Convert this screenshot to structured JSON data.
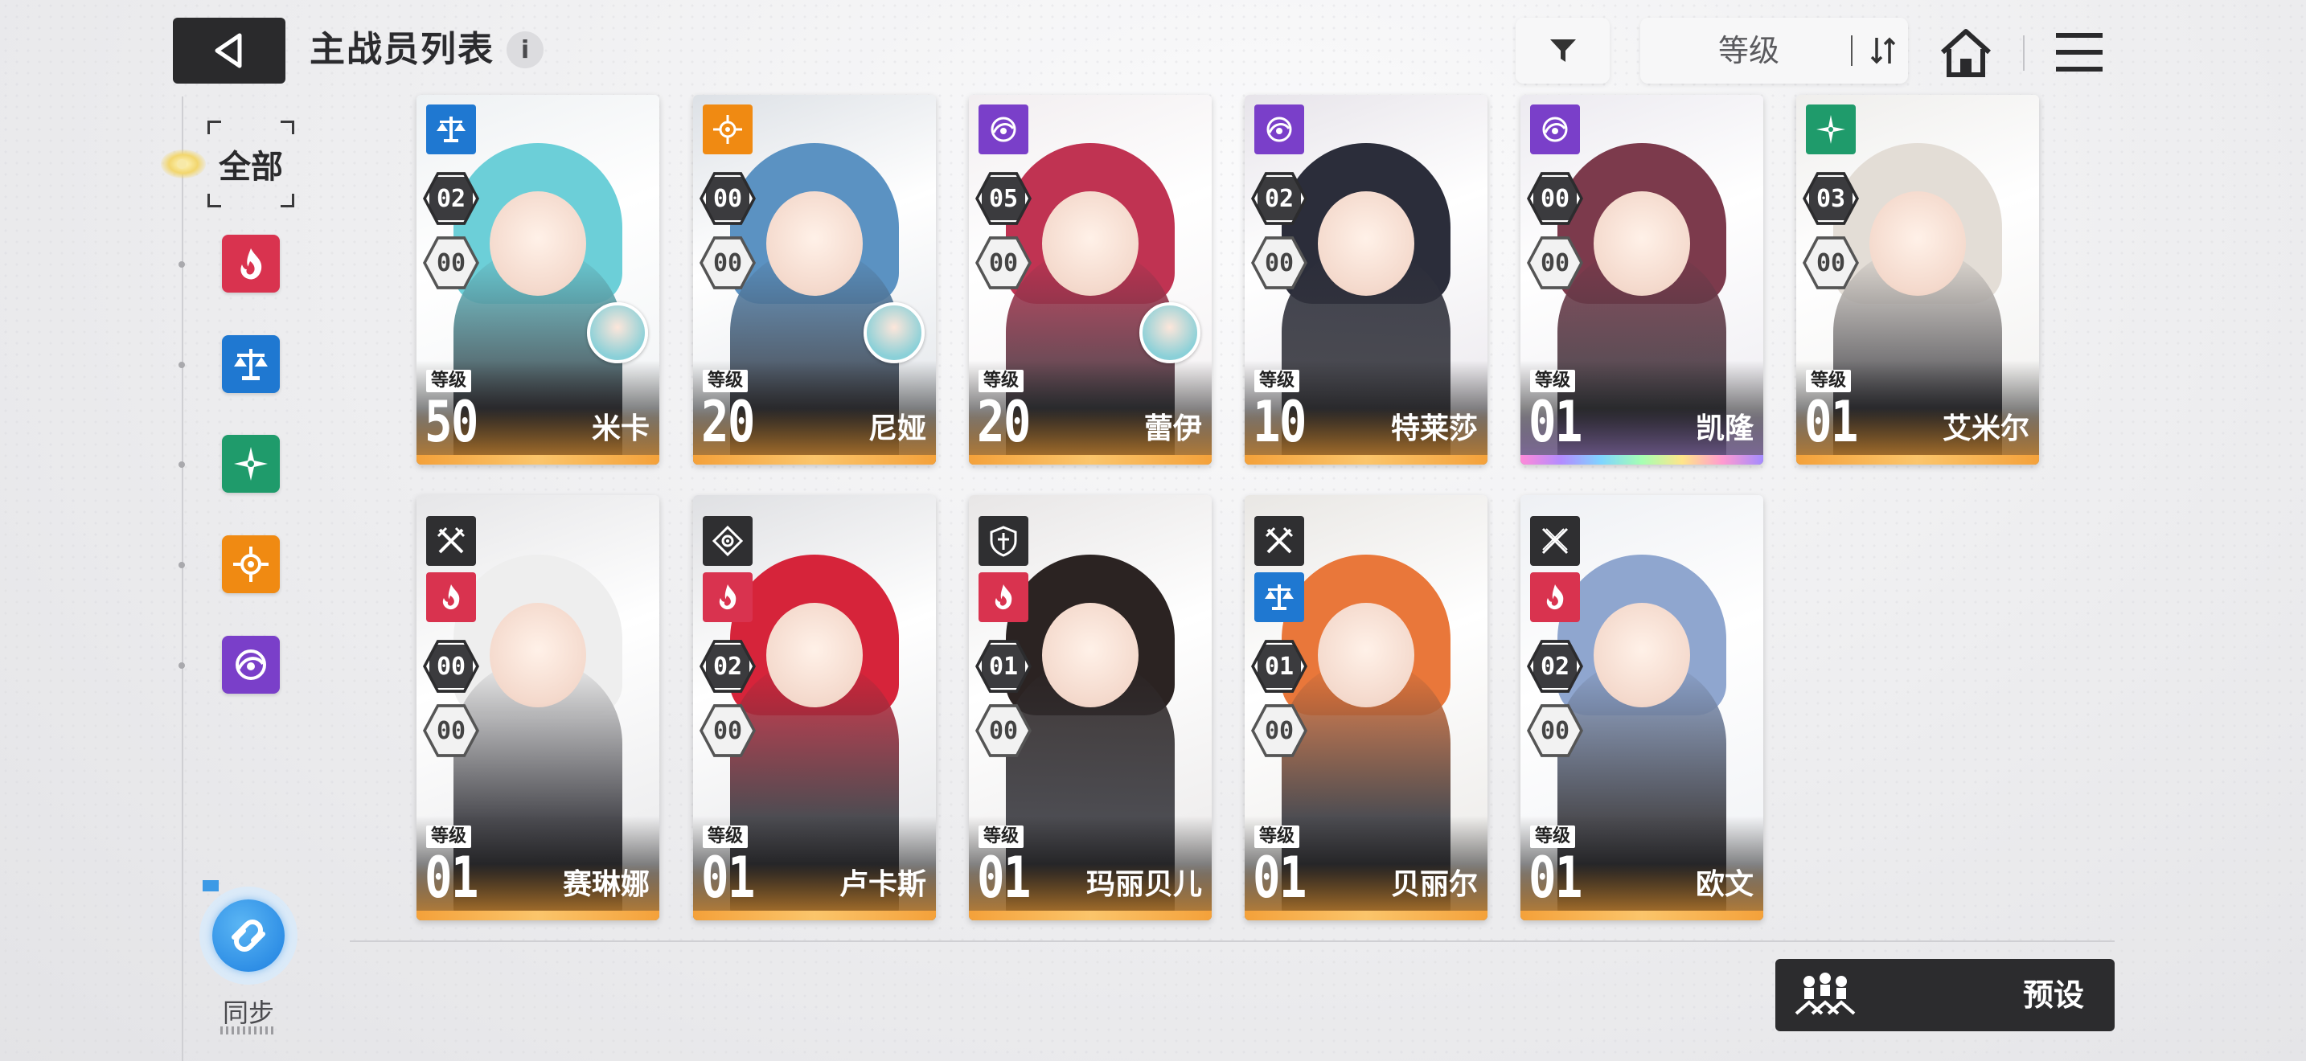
{
  "header": {
    "title": "主战员列表",
    "info_icon": "i",
    "sort_label": "等级",
    "icons": [
      "back-arrow-icon",
      "filter-funnel-icon",
      "sort-toggle-icon",
      "home-icon",
      "menu-icon"
    ]
  },
  "sidebar": {
    "all_label": "全部",
    "elements": [
      {
        "name": "fire",
        "color": "#d9334f"
      },
      {
        "name": "balance",
        "color": "#1f78d1"
      },
      {
        "name": "wind",
        "color": "#1f9b6b"
      },
      {
        "name": "radiant",
        "color": "#f08a12"
      },
      {
        "name": "void",
        "color": "#7a3fc9"
      }
    ],
    "sync_label": "同步"
  },
  "cards": [
    {
      "name": "米卡",
      "level_label": "等级",
      "level": "50",
      "upper": "02",
      "lower": "00",
      "element": "balance",
      "elem_color": "#1f78d1",
      "rarity": "orange",
      "has_avatar": true,
      "hair": "#6ccfd8",
      "bg": "#eef1f3"
    },
    {
      "name": "尼娅",
      "level_label": "等级",
      "level": "20",
      "upper": "00",
      "lower": "00",
      "element": "radiant",
      "elem_color": "#f08a12",
      "rarity": "orange",
      "has_avatar": true,
      "hair": "#5b92c2",
      "bg": "#dde1e6"
    },
    {
      "name": "蕾伊",
      "level_label": "等级",
      "level": "20",
      "upper": "05",
      "lower": "00",
      "element": "void",
      "elem_color": "#7a3fc9",
      "rarity": "orange",
      "has_avatar": true,
      "hair": "#c03352",
      "bg": "#f2eef0"
    },
    {
      "name": "特莱莎",
      "level_label": "等级",
      "level": "10",
      "upper": "02",
      "lower": "00",
      "element": "void",
      "elem_color": "#7a3fc9",
      "rarity": "orange",
      "has_avatar": false,
      "hair": "#2b2d3a",
      "bg": "#e7e4ea"
    },
    {
      "name": "凯隆",
      "level_label": "等级",
      "level": "01",
      "upper": "00",
      "lower": "00",
      "element": "void",
      "elem_color": "#7a3fc9",
      "rarity": "rainbow",
      "has_avatar": false,
      "hair": "#7c3a4c",
      "bg": "#eceaf0"
    },
    {
      "name": "艾米尔",
      "level_label": "等级",
      "level": "01",
      "upper": "03",
      "lower": "00",
      "element": "wind",
      "elem_color": "#1f9b6b",
      "rarity": "orange",
      "has_avatar": false,
      "hair": "#e3ddd6",
      "bg": "#efeeec"
    },
    {
      "name": "赛琳娜",
      "level_label": "等级",
      "level": "01",
      "upper": "00",
      "lower": "00",
      "element": "fire",
      "elem_color": "#d9334f",
      "rarity": "orange",
      "role": "swords",
      "hair": "#eeeeee",
      "bg": "#e6e6e8"
    },
    {
      "name": "卢卡斯",
      "level_label": "等级",
      "level": "01",
      "upper": "02",
      "lower": "00",
      "element": "fire",
      "elem_color": "#d9334f",
      "rarity": "orange",
      "role": "target",
      "hair": "#d6243a",
      "bg": "#dfe0e3"
    },
    {
      "name": "玛丽贝儿",
      "level_label": "等级",
      "level": "01",
      "upper": "01",
      "lower": "00",
      "element": "fire",
      "elem_color": "#d9334f",
      "rarity": "orange",
      "role": "shield",
      "hair": "#2b2322",
      "bg": "#e8e6e6"
    },
    {
      "name": "贝丽尔",
      "level_label": "等级",
      "level": "01",
      "upper": "01",
      "lower": "00",
      "element": "balance",
      "elem_color": "#1f78d1",
      "rarity": "orange",
      "role": "swords",
      "hair": "#e9773a",
      "bg": "#e9e7e4"
    },
    {
      "name": "欧文",
      "level_label": "等级",
      "level": "01",
      "upper": "02",
      "lower": "00",
      "element": "fire",
      "elem_color": "#d9334f",
      "rarity": "orange",
      "role": "crossed-blades",
      "hair": "#8fa6cf",
      "bg": "#eef0f4"
    }
  ],
  "footer": {
    "preset_label": "预设"
  }
}
